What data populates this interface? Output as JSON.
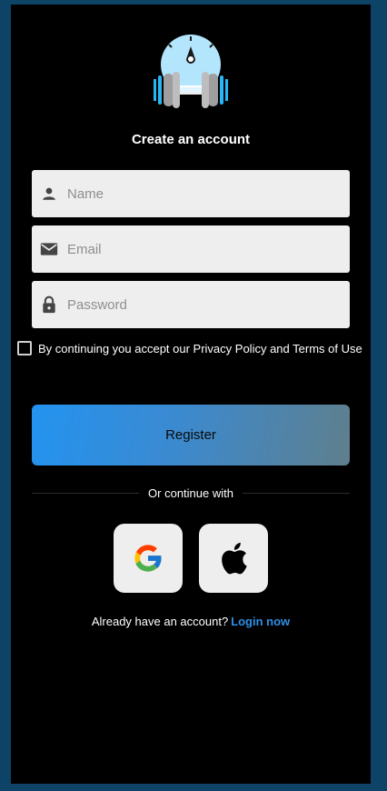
{
  "header": {
    "title": "Create an account"
  },
  "form": {
    "name": {
      "placeholder": "Name",
      "icon": "person-icon"
    },
    "email": {
      "placeholder": "Email",
      "icon": "mail-icon"
    },
    "password": {
      "placeholder": "Password",
      "icon": "lock-icon"
    },
    "terms_text": "By continuing you accept our Privacy Policy and Terms of Use",
    "terms_checked": false
  },
  "register_label": "Register",
  "divider_text": "Or continue with",
  "social": [
    {
      "name": "google-icon"
    },
    {
      "name": "apple-icon"
    }
  ],
  "footer": {
    "prompt": "Already have an account?",
    "link": "Login now"
  },
  "colors": {
    "background": "#0d4366",
    "screen": "#000000",
    "field": "#eeeeee",
    "accent_link": "#2e8fe6",
    "button_gradient_start": "#2393f0",
    "button_gradient_end": "#5f7f8d"
  }
}
